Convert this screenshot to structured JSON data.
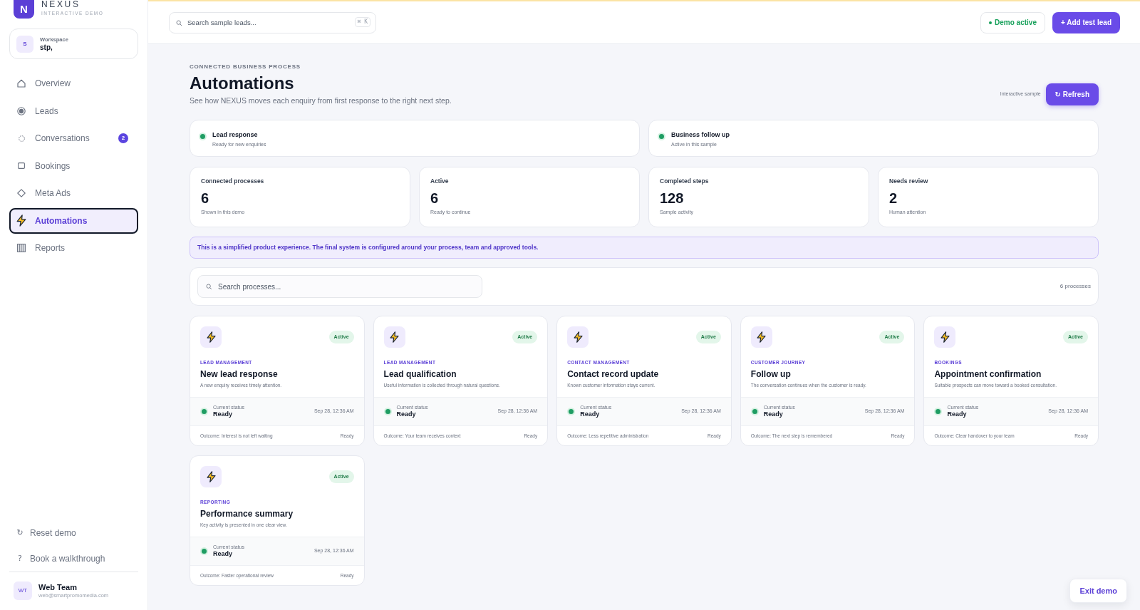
{
  "sidebar": {
    "brand": {
      "logo_letter": "N",
      "name": "NEXUS",
      "tagline": "INTERACTIVE DEMO"
    },
    "workspace": {
      "avatar": "S",
      "label": "Workspace",
      "name": "stp,"
    },
    "nav": [
      {
        "label": "Overview",
        "selected": false
      },
      {
        "label": "Leads",
        "selected": false
      },
      {
        "label": "Conversations",
        "selected": false,
        "badge": "2"
      },
      {
        "label": "Bookings",
        "selected": false
      },
      {
        "label": "Meta Ads",
        "selected": false
      },
      {
        "label": "Automations",
        "selected": true
      },
      {
        "label": "Reports",
        "selected": false
      }
    ],
    "footer_links": [
      {
        "icon": "↻",
        "label": "Reset demo"
      },
      {
        "icon": "?",
        "label": "Book a walkthrough"
      }
    ],
    "user": {
      "avatar": "WT",
      "name": "Web Team",
      "email": "web@smartpromomedia.com"
    }
  },
  "top_bar": {
    "search": {
      "placeholder": "Search sample leads...",
      "shortcut": "⌘ K"
    },
    "demo_status": "Demo active",
    "add_button": "+ Add test lead"
  },
  "header": {
    "eyebrow": "CONNECTED BUSINESS PROCESS",
    "title": "Automations",
    "subtitle": "See how NEXUS moves each enquiry from first response to the right next step.",
    "note": "Interactive sample",
    "refresh_button": "↻ Refresh"
  },
  "process_status": [
    {
      "title": "Lead response",
      "subtitle": "Ready for new enquiries"
    },
    {
      "title": "Business follow up",
      "subtitle": "Active in this sample"
    }
  ],
  "stats": [
    {
      "label": "Connected processes",
      "value": "6",
      "note": "Shown in this demo"
    },
    {
      "label": "Active",
      "value": "6",
      "note": "Ready to continue"
    },
    {
      "label": "Completed steps",
      "value": "128",
      "note": "Sample activity"
    },
    {
      "label": "Needs review",
      "value": "2",
      "note": "Human attention"
    }
  ],
  "notice": "This is a simplified product experience. The final system is configured around your process, team and approved tools.",
  "process_search": {
    "placeholder": "Search processes...",
    "count": "6 processes"
  },
  "processes": [
    {
      "category": "LEAD MANAGEMENT",
      "title": "New lead response",
      "description": "A new enquiry receives timely attention.",
      "badge": "Active",
      "status_label": "Current status",
      "status": "Ready",
      "timestamp": "Sep 28, 12:36 AM",
      "outcome": "Outcome: Interest is not left waiting",
      "outcome_status": "Ready"
    },
    {
      "category": "LEAD MANAGEMENT",
      "title": "Lead qualification",
      "description": "Useful information is collected through natural questions.",
      "badge": "Active",
      "status_label": "Current status",
      "status": "Ready",
      "timestamp": "Sep 28, 12:36 AM",
      "outcome": "Outcome: Your team receives context",
      "outcome_status": "Ready"
    },
    {
      "category": "CONTACT MANAGEMENT",
      "title": "Contact record update",
      "description": "Known customer information stays current.",
      "badge": "Active",
      "status_label": "Current status",
      "status": "Ready",
      "timestamp": "Sep 28, 12:36 AM",
      "outcome": "Outcome: Less repetitive administration",
      "outcome_status": "Ready"
    },
    {
      "category": "CUSTOMER JOURNEY",
      "title": "Follow up",
      "description": "The conversation continues when the customer is ready.",
      "badge": "Active",
      "status_label": "Current status",
      "status": "Ready",
      "timestamp": "Sep 28, 12:36 AM",
      "outcome": "Outcome: The next step is remembered",
      "outcome_status": "Ready"
    },
    {
      "category": "BOOKINGS",
      "title": "Appointment confirmation",
      "description": "Suitable prospects can move toward a booked consultation.",
      "badge": "Active",
      "status_label": "Current status",
      "status": "Ready",
      "timestamp": "Sep 28, 12:36 AM",
      "outcome": "Outcome: Clear handover to your team",
      "outcome_status": "Ready"
    },
    {
      "category": "REPORTING",
      "title": "Performance summary",
      "description": "Key activity is presented in one clear view.",
      "badge": "Active",
      "status_label": "Current status",
      "status": "Ready",
      "timestamp": "Sep 28, 12:36 AM",
      "outcome": "Outcome: Faster operational review",
      "outcome_status": "Ready"
    }
  ],
  "exit_button": "Exit demo"
}
